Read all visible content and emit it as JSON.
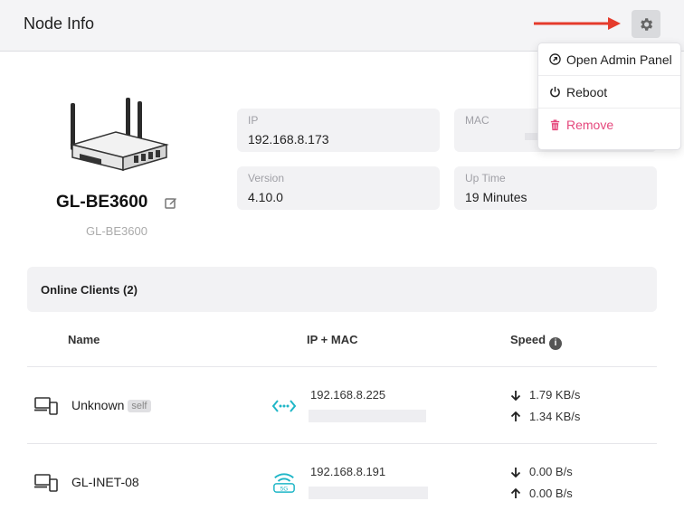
{
  "header": {
    "title": "Node Info"
  },
  "device": {
    "name": "GL-BE3600",
    "model": "GL-BE3600"
  },
  "info": {
    "ip": {
      "label": "IP",
      "value": "192.168.8.173"
    },
    "mac": {
      "label": "MAC"
    },
    "version": {
      "label": "Version",
      "value": "4.10.0"
    },
    "uptime": {
      "label": "Up Time",
      "value": "19 Minutes"
    }
  },
  "menu": {
    "items": [
      {
        "label": "Open Admin Panel",
        "icon": "open-external-icon"
      },
      {
        "label": "Reboot",
        "icon": "power-icon"
      },
      {
        "label": "Remove",
        "icon": "trash-icon",
        "color": "#e5487d"
      }
    ]
  },
  "clients": {
    "title": "Online Clients (2)",
    "columns": {
      "name": "Name",
      "ipmac": "IP + MAC",
      "speed": "Speed"
    },
    "rows": [
      {
        "name": "Unknown",
        "badge": "self",
        "connection": "ethernet-icon",
        "ip": "192.168.8.225",
        "down": "1.79 KB/s",
        "up": "1.34 KB/s"
      },
      {
        "name": "GL-INET-08",
        "badge": "",
        "connection": "wifi-5g-icon",
        "ip": "192.168.8.191",
        "down": "0.00 B/s",
        "up": "0.00 B/s"
      }
    ]
  },
  "colors": {
    "accent_teal": "#1fb6c7",
    "danger": "#e5487d",
    "arrow": "#e53b2c"
  }
}
